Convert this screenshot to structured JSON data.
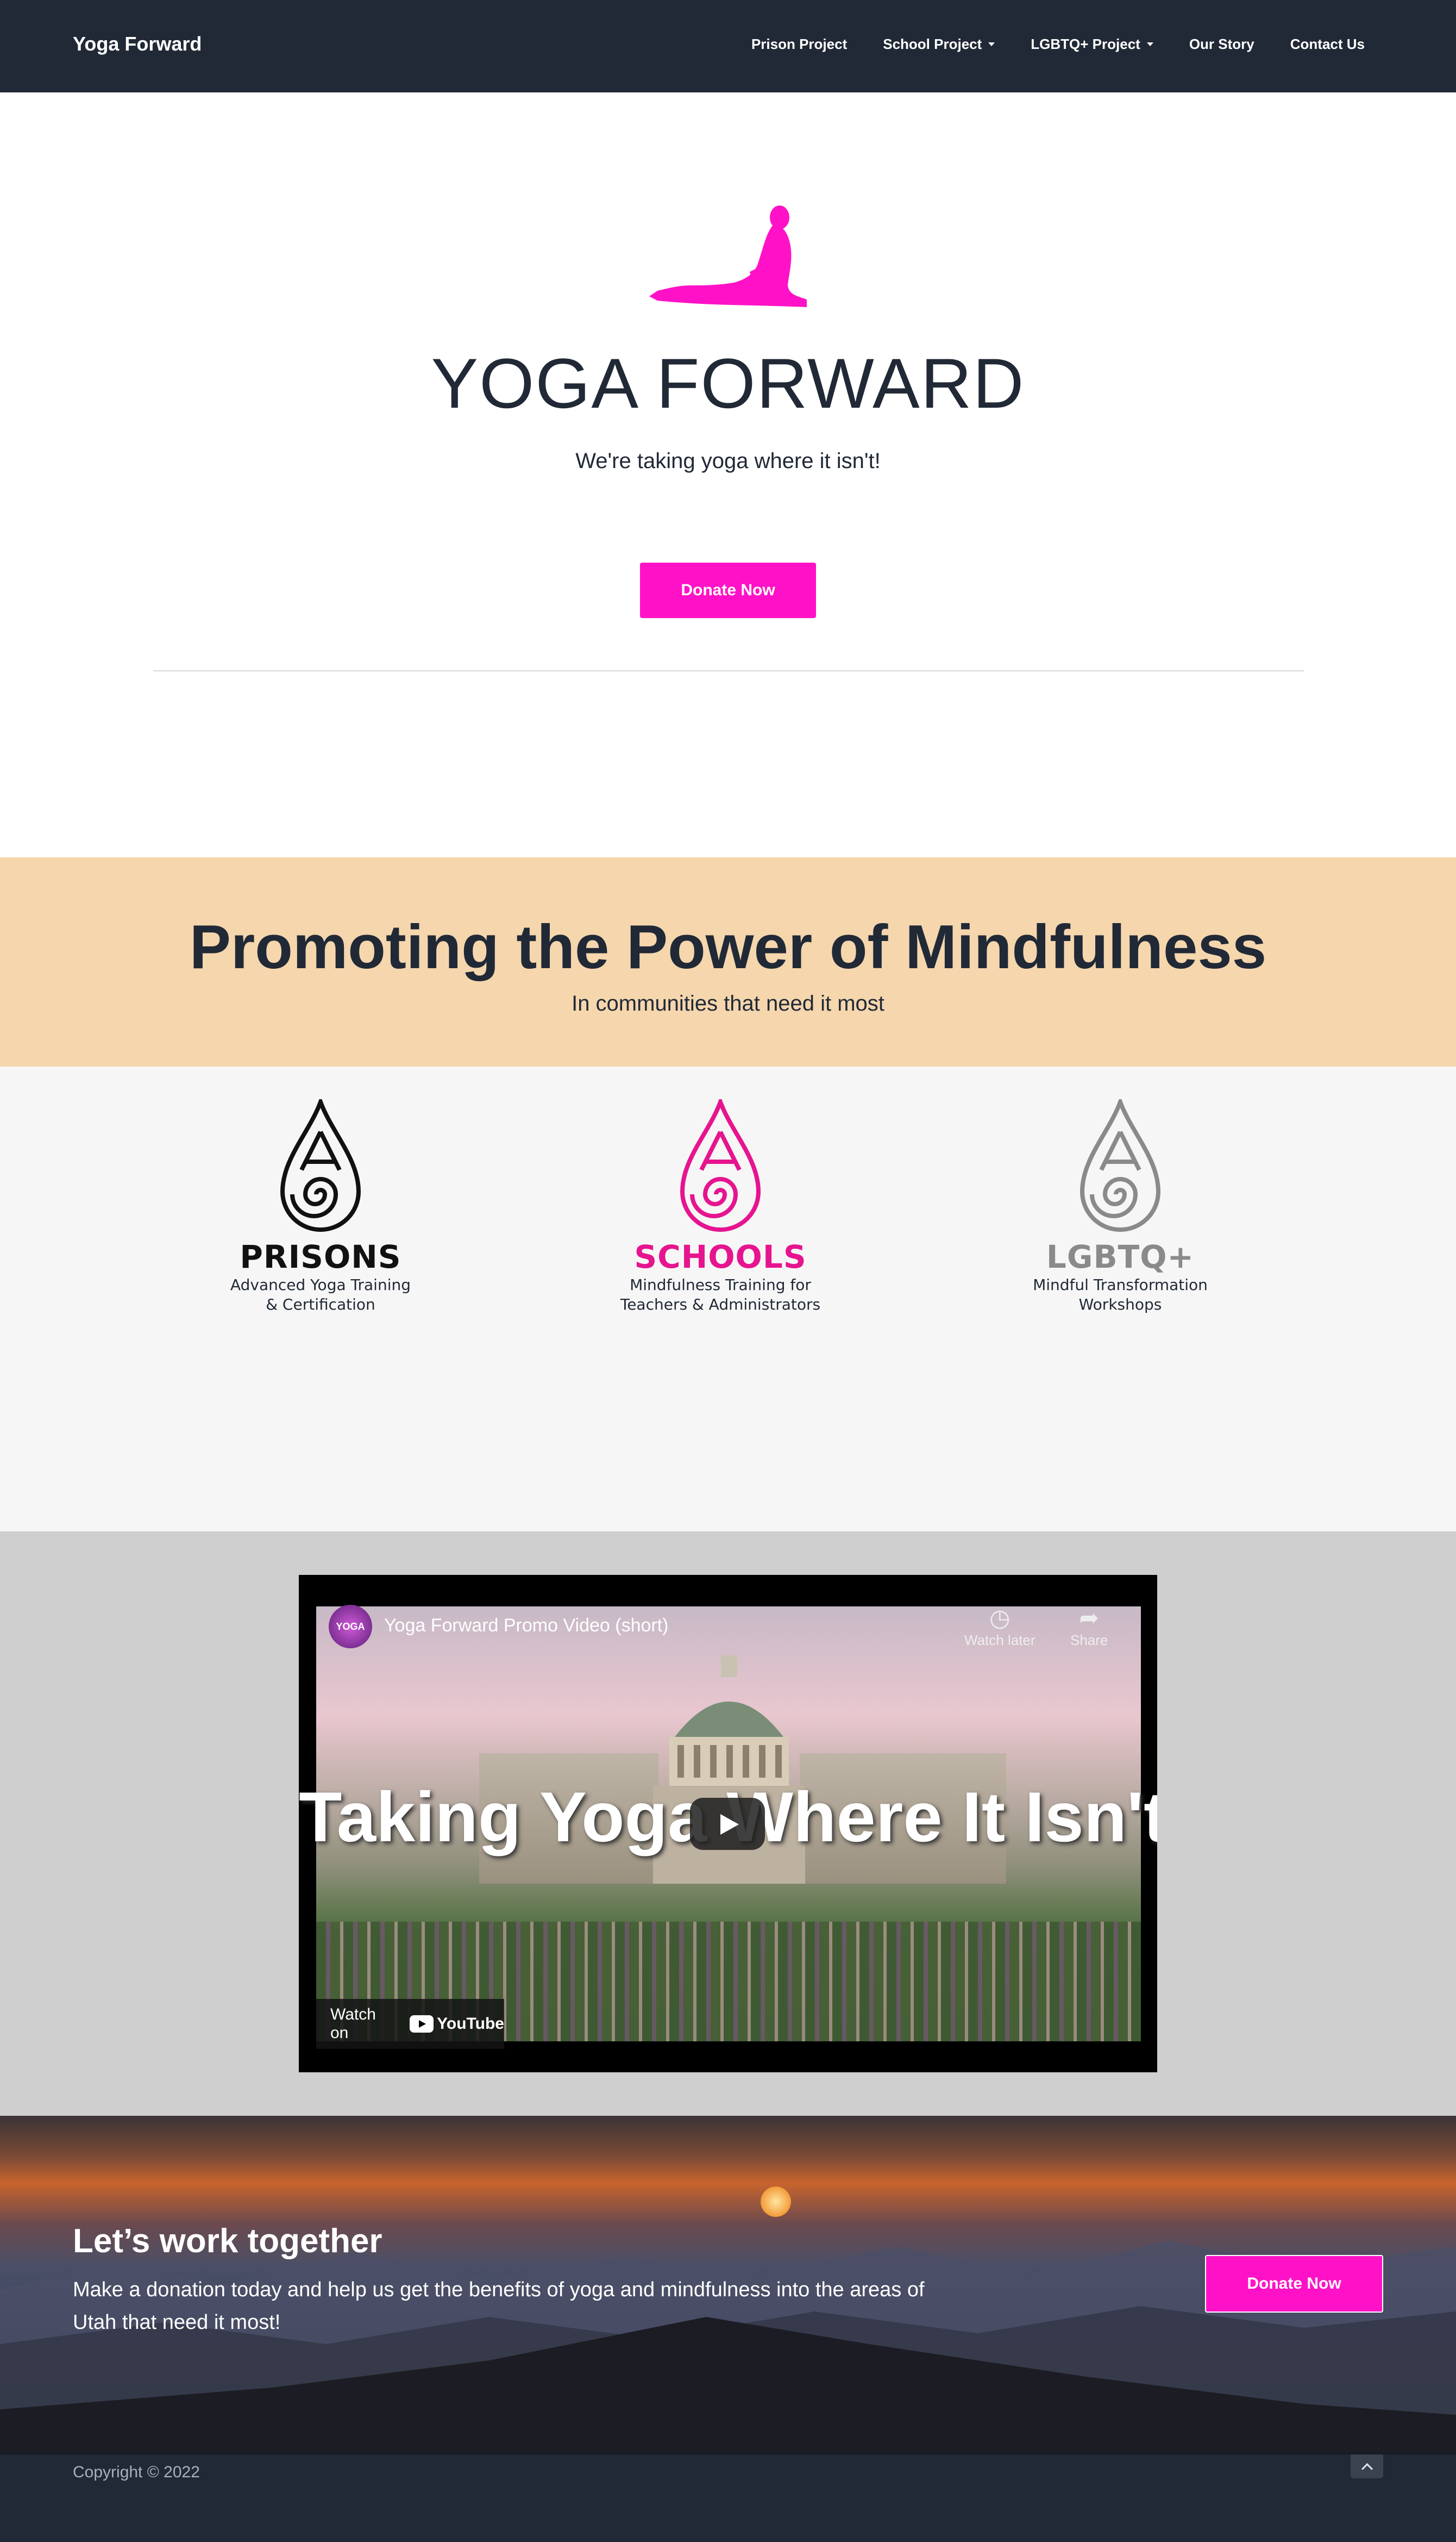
{
  "nav": {
    "brand": "Yoga Forward",
    "items": [
      {
        "label": "Prison Project",
        "dropdown": false
      },
      {
        "label": "School Project",
        "dropdown": true
      },
      {
        "label": "LGBTQ+ Project",
        "dropdown": true
      },
      {
        "label": "Our Story",
        "dropdown": false
      },
      {
        "label": "Contact Us",
        "dropdown": false
      }
    ]
  },
  "hero": {
    "title": "YOGA FORWARD",
    "subtitle": "We're taking yoga where it isn't!",
    "button": "Donate Now",
    "figure_icon": "yoga-cobra-pose-icon"
  },
  "mission": {
    "title": "Promoting the Power of Mindfulness",
    "subtitle": "In communities that need it most"
  },
  "programs": [
    {
      "name": "PRISONS",
      "desc_line1": "Advanced Yoga Training",
      "desc_line2": "& Certification",
      "color": "#111111"
    },
    {
      "name": "SCHOOLS",
      "desc_line1": "Mindfulness Training for",
      "desc_line2": "Teachers & Administrators",
      "color": "#e6148f"
    },
    {
      "name": "LGBTQ+",
      "desc_line1": "Mindful Transformation",
      "desc_line2": "Workshops",
      "color": "#8a8a8a"
    }
  ],
  "video": {
    "channel_logo": "YOGA",
    "title": "Yoga Forward Promo Video (short)",
    "watch_later": "Watch later",
    "share": "Share",
    "overlay_text": "Taking Yoga Where It Isn't",
    "watch_on": "Watch on",
    "youtube": "YouTube"
  },
  "cta": {
    "title": "Let’s work together",
    "text": "Make a donation today and help us get the benefits of yoga and mindfulness into the areas of Utah that need it most!",
    "button": "Donate Now"
  },
  "footer": {
    "copyright": "Copyright © 2022"
  },
  "colors": {
    "navy": "#212936",
    "pink": "#ff12c7",
    "band": "#f5d6ad"
  }
}
